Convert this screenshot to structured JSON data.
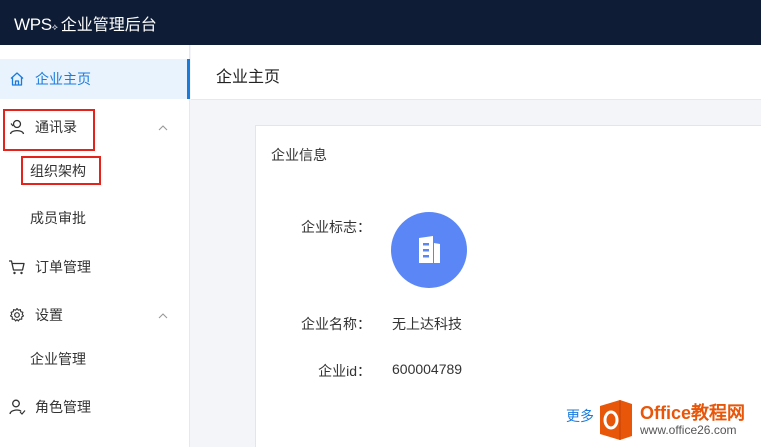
{
  "app": {
    "logo_text": "WPS",
    "logo_sup": "⟡",
    "title": "企业管理后台"
  },
  "sidebar": {
    "items": [
      {
        "label": "企业主页",
        "icon": "home-icon",
        "active": true
      },
      {
        "label": "通讯录",
        "icon": "contacts-icon",
        "expanded": true
      },
      {
        "label": "组织架构",
        "sub": true
      },
      {
        "label": "成员审批",
        "sub": true
      },
      {
        "label": "订单管理",
        "icon": "cart-icon"
      },
      {
        "label": "设置",
        "icon": "gear-icon",
        "expanded": true
      },
      {
        "label": "企业管理",
        "sub": true
      },
      {
        "label": "角色管理",
        "icon": "user-role-icon"
      }
    ]
  },
  "main": {
    "page_title": "企业主页",
    "card": {
      "title": "企业信息",
      "logo_label": "企业标志：",
      "name_label": "企业名称：",
      "name_value": "无上达科技",
      "id_label": "企业id：",
      "id_value": "600004789",
      "more_link": "更多"
    }
  },
  "watermark": {
    "main": "Office教程网",
    "sub": "www.office26.com"
  },
  "colors": {
    "topbar": "#0e1c36",
    "accent": "#1a7bde",
    "highlight_box": "#e3231c",
    "logo_bg": "#5b87f6"
  }
}
